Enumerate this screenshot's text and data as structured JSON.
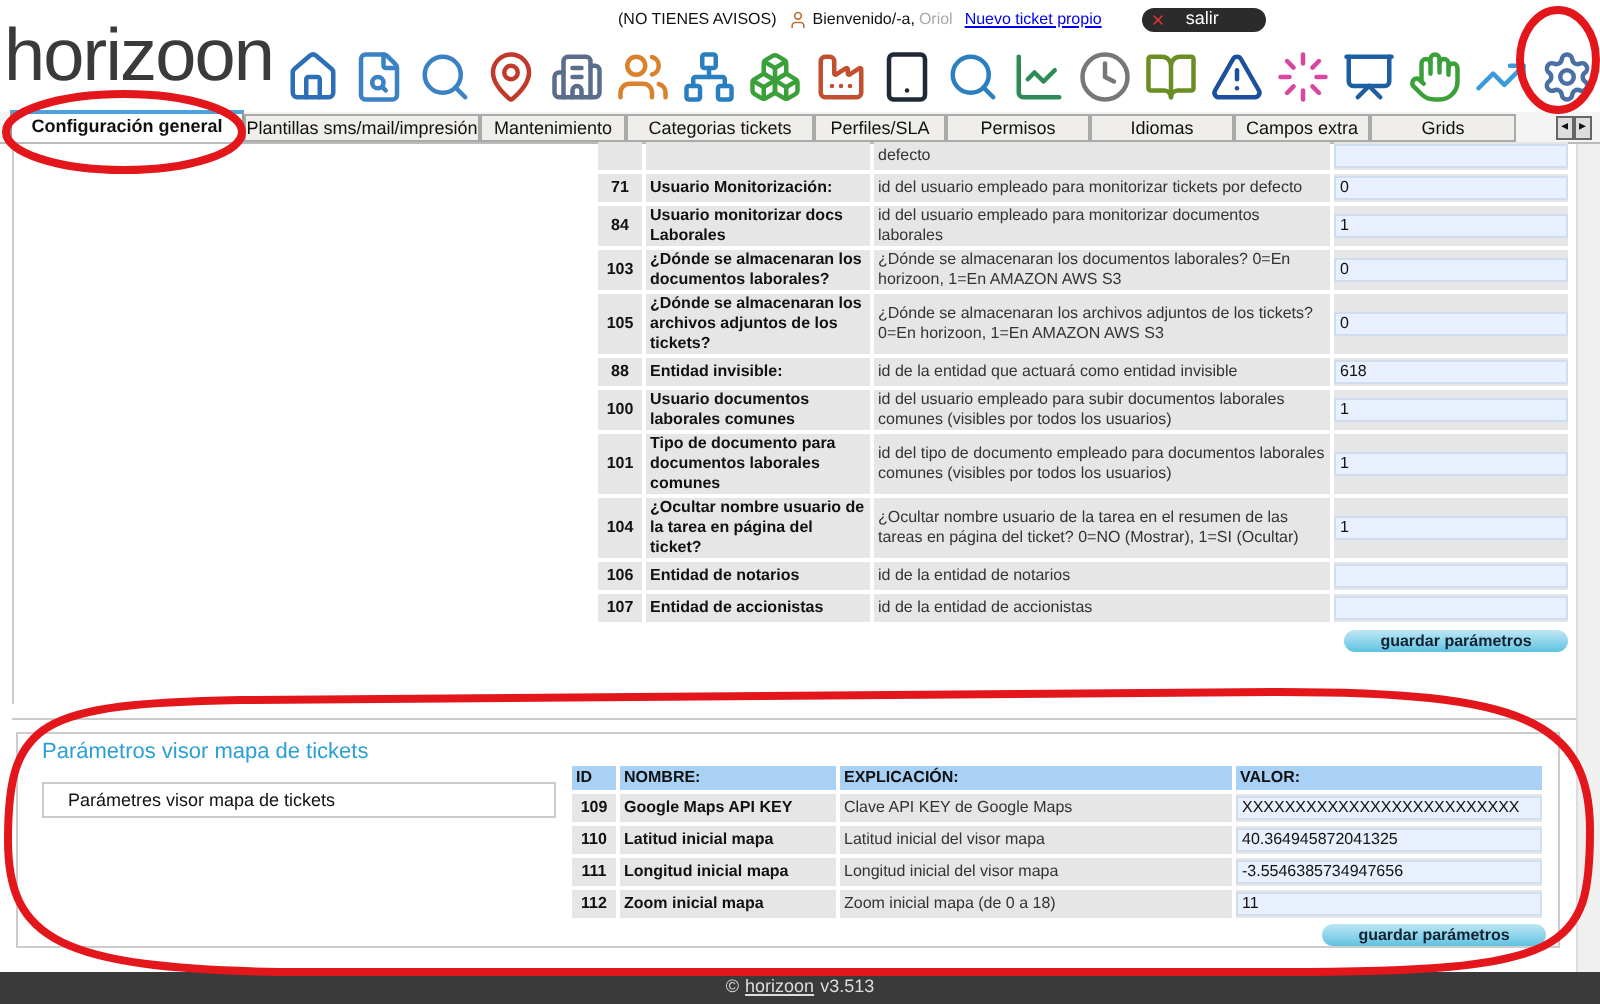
{
  "header": {
    "logo": "horizoon",
    "notices": "(NO TIENES AVISOS)",
    "welcome": "Bienvenido/-a,",
    "user": "Oriol",
    "new_ticket_link": "Nuevo ticket propio",
    "logout": "salir"
  },
  "tabs": [
    {
      "label": "Configuración general",
      "selected": true
    },
    {
      "label": "Plantillas sms/mail/impresión",
      "selected": false
    },
    {
      "label": "Mantenimiento",
      "selected": false
    },
    {
      "label": "Categorias tickets",
      "selected": false
    },
    {
      "label": "Perfiles/SLA",
      "selected": false
    },
    {
      "label": "Permisos",
      "selected": false
    },
    {
      "label": "Idiomas",
      "selected": false
    },
    {
      "label": "Campos extra",
      "selected": false
    },
    {
      "label": "Grids",
      "selected": false
    }
  ],
  "tab_scroll": [
    "◂",
    "▸"
  ],
  "general_params": {
    "rows": [
      {
        "id": "",
        "name": "",
        "description": "defecto",
        "value": ""
      },
      {
        "id": "71",
        "name": "Usuario Monitorización:",
        "description": "id del usuario empleado para monitorizar tickets por defecto",
        "value": "0"
      },
      {
        "id": "84",
        "name": "Usuario monitorizar docs Laborales",
        "description": "id del usuario empleado para monitorizar documentos laborales",
        "value": "1"
      },
      {
        "id": "103",
        "name": "¿Dónde se almacenaran los documentos laborales?",
        "description": "¿Dónde se almacenaran los documentos laborales? 0=En horizoon, 1=En AMAZON AWS S3",
        "value": "0"
      },
      {
        "id": "105",
        "name": "¿Dónde se almacenaran los archivos adjuntos de los tickets?",
        "description": "¿Dónde se almacenaran los archivos adjuntos de los tickets? 0=En horizoon, 1=En AMAZON AWS S3",
        "value": "0"
      },
      {
        "id": "88",
        "name": "Entidad invisible:",
        "description": "id de la entidad que actuará como entidad invisible",
        "value": "618"
      },
      {
        "id": "100",
        "name": "Usuario documentos laborales comunes",
        "description": "id del usuario empleado para subir documentos laborales comunes (visibles por todos los usuarios)",
        "value": "1"
      },
      {
        "id": "101",
        "name": "Tipo de documento para documentos laborales comunes",
        "description": "id del tipo de documento empleado para documentos laborales comunes (visibles por todos los usuarios)",
        "value": "1"
      },
      {
        "id": "104",
        "name": "¿Ocultar nombre usuario de la tarea en página del ticket?",
        "description": "¿Ocultar nombre usuario de la tarea en el resumen de las tareas en página del ticket? 0=NO (Mostrar), 1=SI (Ocultar)",
        "value": "1"
      },
      {
        "id": "106",
        "name": "Entidad de notarios",
        "description": "id de la entidad de notarios",
        "value": ""
      },
      {
        "id": "107",
        "name": "Entidad de accionistas",
        "description": "id de la entidad de accionistas",
        "value": ""
      }
    ],
    "save_button": "guardar parámetros"
  },
  "map_params": {
    "title": "Parámetros visor mapa de tickets",
    "side_item": "Parámetres visor mapa de tickets",
    "columns": [
      "ID",
      "NOMBRE:",
      "EXPLICACIÓN:",
      "VALOR:"
    ],
    "rows": [
      {
        "id": "109",
        "name": "Google Maps API KEY",
        "description": "Clave API KEY de Google Maps",
        "value": "XXXXXXXXXXXXXXXXXXXXXXXXXX"
      },
      {
        "id": "110",
        "name": "Latitud inicial mapa",
        "description": "Latitud inicial del visor mapa",
        "value": "40.364945872041325"
      },
      {
        "id": "111",
        "name": "Longitud inicial mapa",
        "description": "Longitud inicial del visor mapa",
        "value": "-3.5546385734947656"
      },
      {
        "id": "112",
        "name": "Zoom inicial mapa",
        "description": "Zoom inicial mapa (de 0 a 18)",
        "value": "11"
      }
    ],
    "save_button": "guardar parámetros"
  },
  "footer": {
    "copyright": "©",
    "brand": "horizoon",
    "version": "v3.513"
  }
}
